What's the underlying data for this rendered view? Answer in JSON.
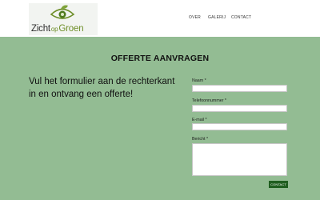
{
  "header": {
    "logo": {
      "word1": "Zicht",
      "word2": "op",
      "word3": "Groen",
      "icon": "eye-leaf-logo-icon"
    },
    "nav": [
      "OVER",
      "GALERIJ",
      "CONTACT"
    ]
  },
  "main": {
    "title": "OFFERTE AANVRAGEN",
    "intro": "Vul het formulier aan de rechterkant in en ontvang een offerte!",
    "form": {
      "naam_label": "Naam *",
      "telefoon_label": "Telefoonnummer *",
      "email_label": "E-mail *",
      "bericht_label": "Bericht *",
      "submit_label": "CONTACT"
    }
  },
  "colors": {
    "section_bg": "#93bc93",
    "submit_bg": "#1f5e1f",
    "logo_green": "#6f8f2a"
  }
}
